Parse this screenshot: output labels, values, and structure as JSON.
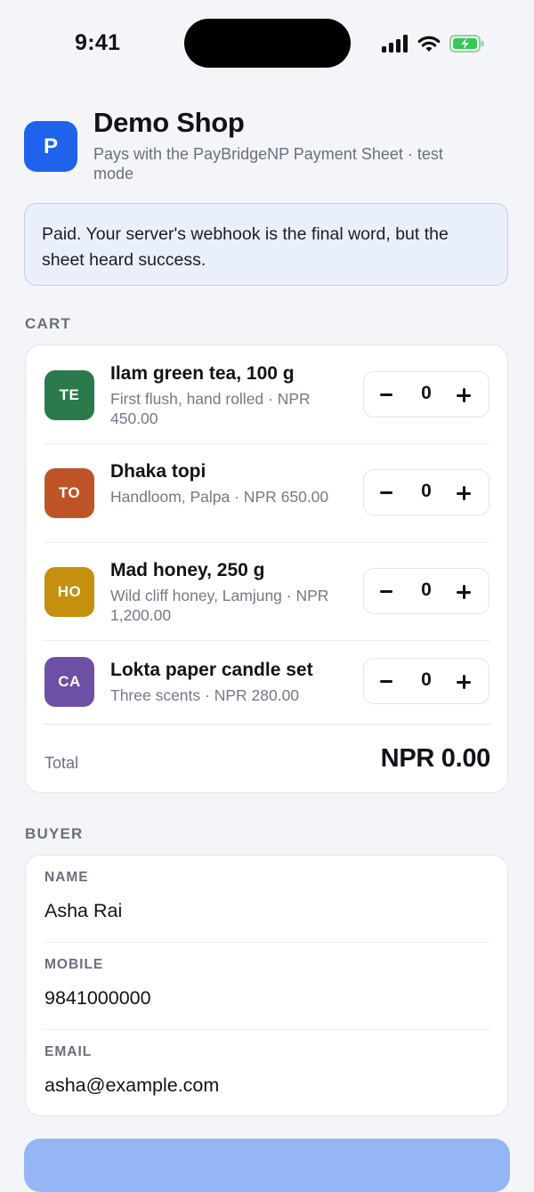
{
  "status_bar": {
    "time": "9:41"
  },
  "header": {
    "icon_letter": "P",
    "title": "Demo Shop",
    "subtitle": "Pays with the PayBridgeNP Payment Sheet · test mode"
  },
  "notice": {
    "text": "Paid. Your server's webhook is the final word, but the sheet heard success."
  },
  "cart": {
    "section_label": "CART",
    "items": [
      {
        "badge": "TE",
        "badge_color": "#2a7a4b",
        "name": "Ilam green tea, 100 g",
        "description": "First flush, hand rolled · NPR 450.00",
        "quantity": "0"
      },
      {
        "badge": "TO",
        "badge_color": "#bf5328",
        "name": "Dhaka topi",
        "description": "Handloom, Palpa · NPR 650.00",
        "quantity": "0"
      },
      {
        "badge": "HO",
        "badge_color": "#c4900e",
        "name": "Mad honey, 250 g",
        "description": "Wild cliff honey, Lamjung · NPR 1,200.00",
        "quantity": "0"
      },
      {
        "badge": "CA",
        "badge_color": "#6d4fa5",
        "name": "Lokta paper candle set",
        "description": "Three scents · NPR 280.00",
        "quantity": "0"
      }
    ],
    "total_label": "Total",
    "total_value": "NPR 0.00"
  },
  "buyer": {
    "section_label": "BUYER",
    "fields": [
      {
        "label": "NAME",
        "value": "Asha Rai"
      },
      {
        "label": "MOBILE",
        "value": "9841000000"
      },
      {
        "label": "EMAIL",
        "value": "asha@example.com"
      }
    ]
  },
  "colors": {
    "accent": "#1f63ed",
    "notice_background": "#e9f0fc",
    "notice_border": "#b9d0f3",
    "pay_button_disabled": "#94b6f4",
    "battery_charging": "#34c759"
  },
  "icons": [
    "signal-icon",
    "wifi-icon",
    "battery-charging-icon",
    "minus-icon",
    "plus-icon"
  ]
}
